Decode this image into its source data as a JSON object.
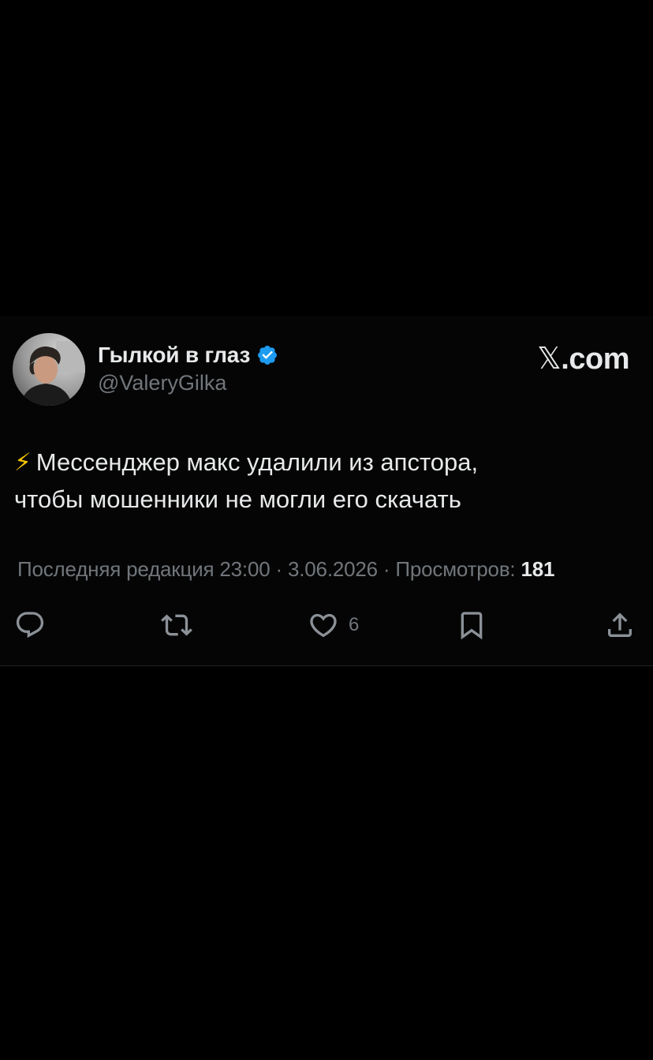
{
  "author": {
    "display_name": "Гылкой в глаз",
    "handle": "@ValeryGilka",
    "avatar_icon": "profile-photo",
    "verified_icon": "verified-badge-icon",
    "verified_color": "#1d9bf0"
  },
  "brand": {
    "x_glyph": "𝕏",
    "suffix": ".com"
  },
  "tweet": {
    "emoji": "⚡",
    "line1": "Мессенджер макс удалили из апстора,",
    "line2": "чтобы мошенники не могли его скачать"
  },
  "meta": {
    "prefix": "Последняя редакция",
    "time": "23:00",
    "date": "3.06.2026",
    "views_label": "Просмотров:",
    "views_count": "181"
  },
  "actions": {
    "reply_icon": "reply-icon",
    "retweet_icon": "retweet-icon",
    "like_icon": "heart-icon",
    "like_count": "6",
    "bookmark_icon": "bookmark-icon",
    "share_icon": "share-icon"
  },
  "colors": {
    "background": "#000000",
    "text": "#e7e9ea",
    "secondary_text": "#71767b",
    "accent": "#1d9bf0"
  }
}
